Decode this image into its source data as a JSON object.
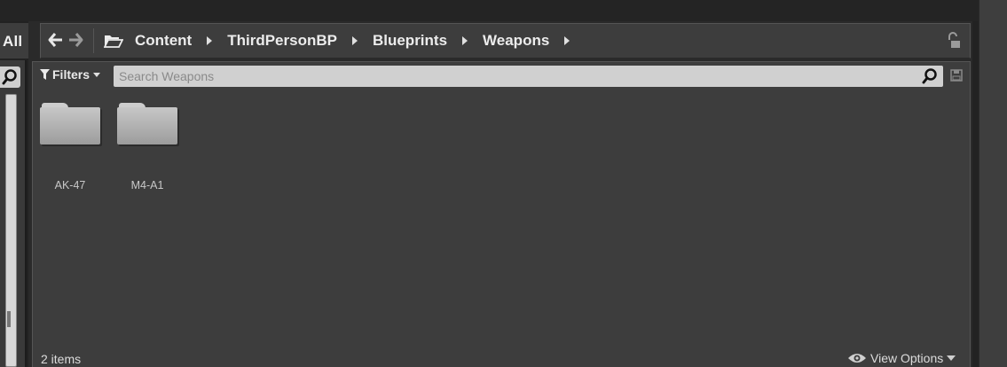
{
  "left_panel": {
    "all_label": "All"
  },
  "breadcrumb": [
    "Content",
    "ThirdPersonBP",
    "Blueprints",
    "Weapons"
  ],
  "filters": {
    "label": "Filters"
  },
  "search": {
    "placeholder": "Search Weapons",
    "value": ""
  },
  "assets": [
    {
      "name": "AK-47",
      "type": "folder"
    },
    {
      "name": "M4-A1",
      "type": "folder"
    }
  ],
  "status": {
    "item_count": "2 items"
  },
  "view_options": {
    "label": "View Options"
  },
  "icons": {
    "back": "arrow-left-icon",
    "forward": "arrow-right-icon",
    "folder": "folder-open-icon",
    "lock": "unlock-icon",
    "search": "search-icon",
    "save": "save-icon",
    "eye": "eye-icon",
    "filter": "funnel-icon"
  },
  "colors": {
    "panel": "#3d3d3d",
    "background": "#2a2a2a",
    "search_field": "#d0d0d0",
    "text": "#e6e6e6"
  }
}
